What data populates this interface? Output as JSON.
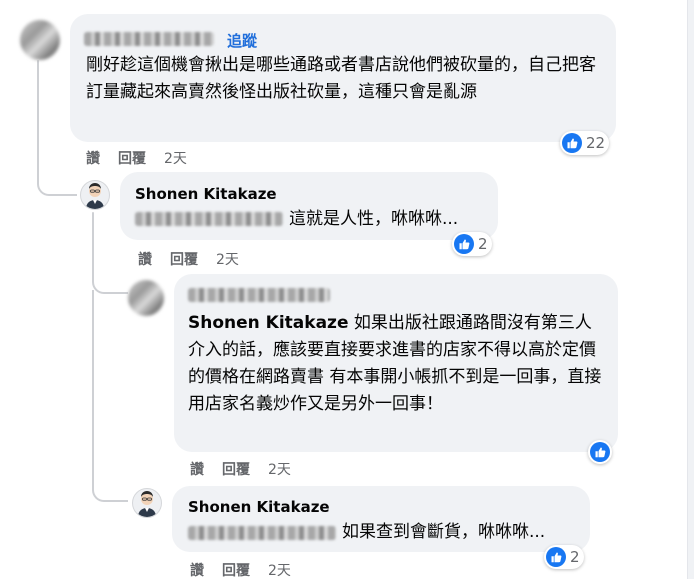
{
  "comment1": {
    "follow_label": "追蹤",
    "text": "剛好趁這個機會揪出是哪些通路或者書店說他們被砍量的，自己把客訂量藏起來高賣然後怪出版社砍量，這種只會是亂源",
    "like_count": "22",
    "actions": {
      "like": "讚",
      "reply": "回覆",
      "time": "2天"
    }
  },
  "reply1": {
    "author": "Shonen Kitakaze",
    "text": "這就是人性，咻咻咻...",
    "like_count": "2",
    "actions": {
      "like": "讚",
      "reply": "回覆",
      "time": "2天"
    }
  },
  "reply2": {
    "mention": "Shonen Kitakaze",
    "text": "如果出版社跟通路間沒有第三人介入的話，應該要直接要求進書的店家不得以高於定價的價格在網路賣書 有本事開小帳抓不到是一回事，直接用店家名義炒作又是另外一回事！",
    "actions": {
      "like": "讚",
      "reply": "回覆",
      "time": "2天"
    }
  },
  "reply3": {
    "author": "Shonen Kitakaze",
    "text": "如果查到會斷貨，咻咻咻...",
    "like_count": "2",
    "actions": {
      "like": "讚",
      "reply": "回覆",
      "time": "2天"
    }
  },
  "colors": {
    "like_blue": "#1877f2",
    "follow_blue": "#216fdb",
    "bubble": "#f0f2f5",
    "meta": "#65676b"
  },
  "icons": {
    "like": "thumbs-up-icon"
  }
}
